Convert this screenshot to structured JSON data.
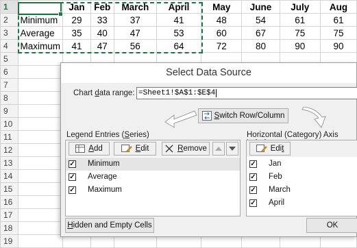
{
  "sheet": {
    "columns": [
      "",
      "",
      "Jan",
      "Feb",
      "March",
      "April",
      "May",
      "June",
      "July",
      "Aug"
    ],
    "header_row": {
      "num": "1",
      "cells": [
        "",
        "Jan",
        "Feb",
        "March",
        "April",
        "May",
        "June",
        "July",
        "Aug"
      ]
    },
    "rows": [
      {
        "num": "2",
        "cells": [
          "Minimum",
          "29",
          "33",
          "37",
          "41",
          "48",
          "54",
          "61",
          "61"
        ]
      },
      {
        "num": "3",
        "cells": [
          "Average",
          "35",
          "40",
          "47",
          "53",
          "60",
          "67",
          "75",
          "75"
        ]
      },
      {
        "num": "4",
        "cells": [
          "Maximum",
          "41",
          "47",
          "56",
          "64",
          "72",
          "80",
          "90",
          "90"
        ]
      }
    ],
    "empty_rows": [
      "5",
      "6",
      "7",
      "8",
      "9",
      "10",
      "11",
      "12",
      "13",
      "14",
      "15",
      "16",
      "17",
      "18",
      "19"
    ]
  },
  "dialog": {
    "title": "Select Data Source",
    "range_label": "Chart data range:",
    "range_value": "=Sheet1!$A$1:$E$4",
    "switch_label": "Switch Row/Column",
    "legend_label": "Legend Entries (Series)",
    "axis_label": "Horizontal (Category) Axis Labels",
    "add_label": "Add",
    "edit_label": "Edit",
    "remove_label": "Remove",
    "axis_edit_label": "Edit",
    "series": [
      "Minimum",
      "Average",
      "Maximum"
    ],
    "categories": [
      "Jan",
      "Feb",
      "March",
      "April"
    ],
    "hidden_label": "Hidden and Empty Cells",
    "ok_label": "OK"
  }
}
